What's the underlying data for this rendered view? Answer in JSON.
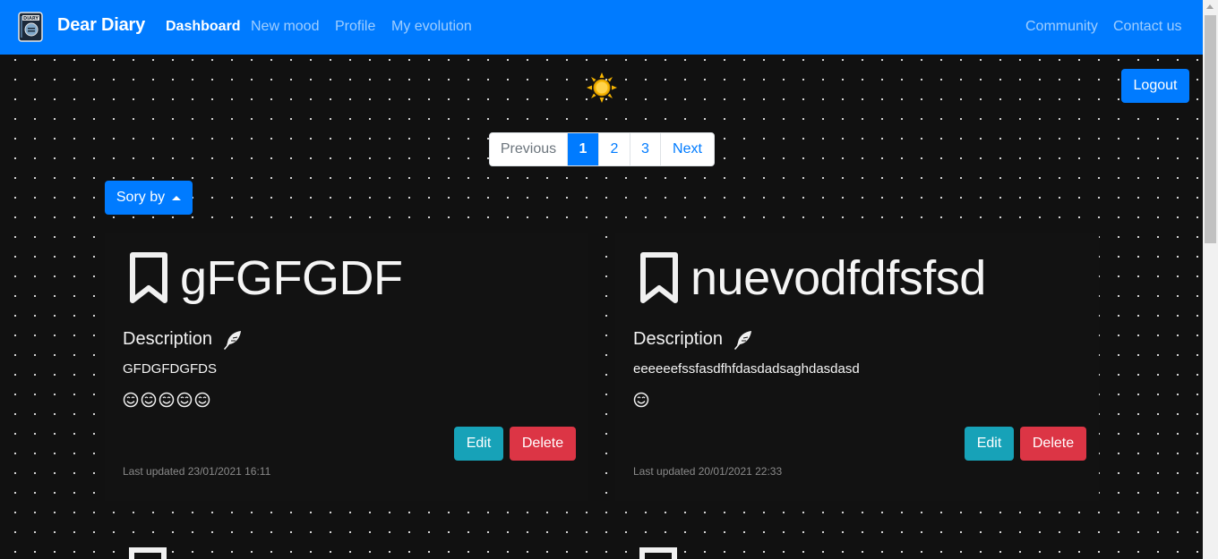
{
  "navbar": {
    "brand": "Dear Diary",
    "logo_icon": "diary-book-icon",
    "links": [
      {
        "label": "Dashboard",
        "active": true
      },
      {
        "label": "New mood",
        "active": false
      },
      {
        "label": "Profile",
        "active": false
      },
      {
        "label": "My evolution",
        "active": false
      }
    ],
    "right_links": [
      {
        "label": "Community"
      },
      {
        "label": "Contact us"
      }
    ]
  },
  "theme_toggle_icon": "sun-icon",
  "logout_label": "Logout",
  "pagination": {
    "previous": "Previous",
    "pages": [
      "1",
      "2",
      "3"
    ],
    "current": "1",
    "next": "Next"
  },
  "sort": {
    "label": "Sory by"
  },
  "entries": [
    {
      "title": "gFGFGDF",
      "description_label": "Description",
      "description": "GFDGFDGFDS",
      "mood_count": 5,
      "edit_label": "Edit",
      "delete_label": "Delete",
      "updated": "Last updated 23/01/2021 16:11"
    },
    {
      "title": "nuevodfdfsfsd",
      "description_label": "Description",
      "description": "eeeeeefssfasdfhfdasdadsaghdasdasd",
      "mood_count": 1,
      "edit_label": "Edit",
      "delete_label": "Delete",
      "updated": "Last updated 20/01/2021 22:33"
    }
  ],
  "colors": {
    "primary": "#007bff",
    "info": "#17a2b8",
    "danger": "#dc3545",
    "background": "#111111"
  }
}
